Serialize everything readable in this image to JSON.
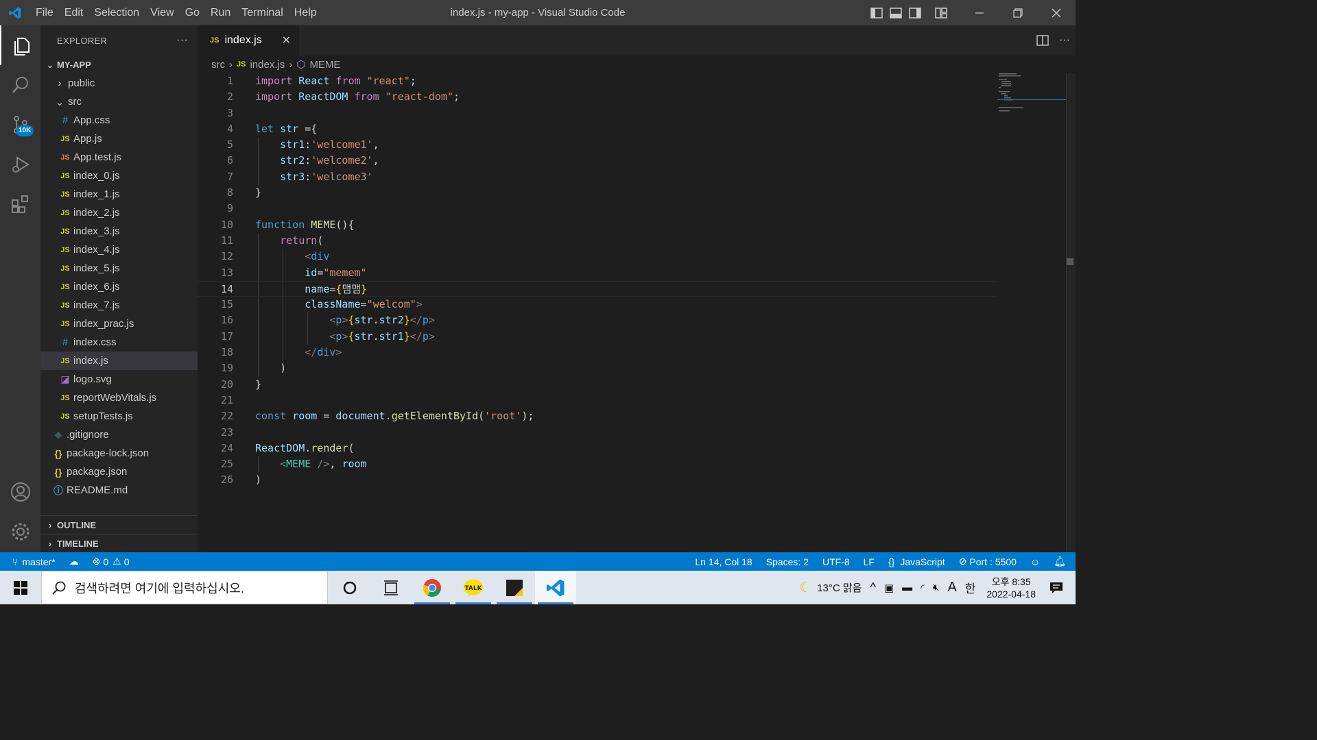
{
  "titlebar": {
    "menu": [
      "File",
      "Edit",
      "Selection",
      "View",
      "Go",
      "Run",
      "Terminal",
      "Help"
    ],
    "title": "index.js - my-app - Visual Studio Code"
  },
  "activitybar": {
    "scm_badge": "10K"
  },
  "explorer": {
    "header": "EXPLORER",
    "more": "···",
    "root": "MY-APP",
    "items": [
      {
        "label": "public",
        "kind": "folder-collapsed",
        "indent": 1
      },
      {
        "label": "src",
        "kind": "folder-open",
        "indent": 1
      },
      {
        "label": "App.css",
        "kind": "css",
        "indent": 2
      },
      {
        "label": "App.js",
        "kind": "js",
        "indent": 2
      },
      {
        "label": "App.test.js",
        "kind": "jstest",
        "indent": 2
      },
      {
        "label": "index_0.js",
        "kind": "js",
        "indent": 2
      },
      {
        "label": "index_1.js",
        "kind": "js",
        "indent": 2
      },
      {
        "label": "index_2.js",
        "kind": "js",
        "indent": 2
      },
      {
        "label": "index_3.js",
        "kind": "js",
        "indent": 2
      },
      {
        "label": "index_4.js",
        "kind": "js",
        "indent": 2
      },
      {
        "label": "index_5.js",
        "kind": "js",
        "indent": 2
      },
      {
        "label": "index_6.js",
        "kind": "js",
        "indent": 2
      },
      {
        "label": "index_7.js",
        "kind": "js",
        "indent": 2
      },
      {
        "label": "index_prac.js",
        "kind": "js",
        "indent": 2
      },
      {
        "label": "index.css",
        "kind": "css",
        "indent": 2
      },
      {
        "label": "index.js",
        "kind": "js",
        "indent": 2,
        "selected": true
      },
      {
        "label": "logo.svg",
        "kind": "svg",
        "indent": 2
      },
      {
        "label": "reportWebVitals.js",
        "kind": "js",
        "indent": 2
      },
      {
        "label": "setupTests.js",
        "kind": "js",
        "indent": 2
      },
      {
        "label": ".gitignore",
        "kind": "git",
        "indent": 1
      },
      {
        "label": "package-lock.json",
        "kind": "json",
        "indent": 1
      },
      {
        "label": "package.json",
        "kind": "json",
        "indent": 1
      },
      {
        "label": "README.md",
        "kind": "info",
        "indent": 1
      }
    ],
    "outline": "OUTLINE",
    "timeline": "TIMELINE"
  },
  "editor": {
    "tab_label": "index.js",
    "tab_badge": "JS",
    "breadcrumb": [
      "src",
      "index.js",
      "MEME"
    ],
    "current_line": 14,
    "lines": [
      [
        [
          "kw2",
          "import"
        ],
        [
          "plain",
          " "
        ],
        [
          "var",
          "React"
        ],
        [
          "plain",
          " "
        ],
        [
          "kw2",
          "from"
        ],
        [
          "plain",
          " "
        ],
        [
          "str",
          "\"react\""
        ],
        [
          "plain",
          ";"
        ]
      ],
      [
        [
          "kw2",
          "import"
        ],
        [
          "plain",
          " "
        ],
        [
          "var",
          "ReactDOM"
        ],
        [
          "plain",
          " "
        ],
        [
          "kw2",
          "from"
        ],
        [
          "plain",
          " "
        ],
        [
          "str",
          "\"react-dom\""
        ],
        [
          "plain",
          ";"
        ]
      ],
      [],
      [
        [
          "kw",
          "let"
        ],
        [
          "plain",
          " "
        ],
        [
          "var",
          "str"
        ],
        [
          "plain",
          " ={"
        ]
      ],
      [
        [
          "plain",
          "    "
        ],
        [
          "var",
          "str1"
        ],
        [
          "plain",
          ":"
        ],
        [
          "str",
          "'welcome1'"
        ],
        [
          "plain",
          ","
        ]
      ],
      [
        [
          "plain",
          "    "
        ],
        [
          "var",
          "str2"
        ],
        [
          "plain",
          ":"
        ],
        [
          "str",
          "'welcome2'"
        ],
        [
          "plain",
          ","
        ]
      ],
      [
        [
          "plain",
          "    "
        ],
        [
          "var",
          "str3"
        ],
        [
          "plain",
          ":"
        ],
        [
          "str",
          "'welcome3'"
        ]
      ],
      [
        [
          "plain",
          "}"
        ]
      ],
      [],
      [
        [
          "kw",
          "function"
        ],
        [
          "plain",
          " "
        ],
        [
          "fn",
          "MEME"
        ],
        [
          "plain",
          "(){"
        ]
      ],
      [
        [
          "plain",
          "    "
        ],
        [
          "kw2",
          "return"
        ],
        [
          "plain",
          "("
        ]
      ],
      [
        [
          "plain",
          "        "
        ],
        [
          "brk",
          "<"
        ],
        [
          "tag",
          "div"
        ]
      ],
      [
        [
          "plain",
          "        "
        ],
        [
          "var",
          "id"
        ],
        [
          "plain",
          "="
        ],
        [
          "str",
          "\"memem\""
        ]
      ],
      [
        [
          "plain",
          "        "
        ],
        [
          "var",
          "name"
        ],
        [
          "plain",
          "="
        ],
        [
          "ybr",
          "{"
        ],
        [
          "plain",
          "맴맴"
        ],
        [
          "ybr",
          "}"
        ]
      ],
      [
        [
          "plain",
          "        "
        ],
        [
          "var",
          "className"
        ],
        [
          "plain",
          "="
        ],
        [
          "str",
          "\"welcom\""
        ],
        [
          "brk",
          ">"
        ]
      ],
      [
        [
          "plain",
          "            "
        ],
        [
          "brk",
          "<"
        ],
        [
          "tag",
          "p"
        ],
        [
          "brk",
          ">"
        ],
        [
          "ybr",
          "{"
        ],
        [
          "var",
          "str"
        ],
        [
          "plain",
          "."
        ],
        [
          "var",
          "str2"
        ],
        [
          "ybr",
          "}"
        ],
        [
          "brk",
          "</"
        ],
        [
          "tag",
          "p"
        ],
        [
          "brk",
          ">"
        ]
      ],
      [
        [
          "plain",
          "            "
        ],
        [
          "brk",
          "<"
        ],
        [
          "tag",
          "p"
        ],
        [
          "brk",
          ">"
        ],
        [
          "ybr",
          "{"
        ],
        [
          "var",
          "str"
        ],
        [
          "plain",
          "."
        ],
        [
          "var",
          "str1"
        ],
        [
          "ybr",
          "}"
        ],
        [
          "brk",
          "</"
        ],
        [
          "tag",
          "p"
        ],
        [
          "brk",
          ">"
        ]
      ],
      [
        [
          "plain",
          "        "
        ],
        [
          "brk",
          "</"
        ],
        [
          "tag",
          "div"
        ],
        [
          "brk",
          ">"
        ]
      ],
      [
        [
          "plain",
          "    )"
        ]
      ],
      [
        [
          "plain",
          "}"
        ]
      ],
      [],
      [
        [
          "kw",
          "const"
        ],
        [
          "plain",
          " "
        ],
        [
          "var",
          "room"
        ],
        [
          "plain",
          " = "
        ],
        [
          "var",
          "document"
        ],
        [
          "plain",
          "."
        ],
        [
          "fn",
          "getElementById"
        ],
        [
          "plain",
          "("
        ],
        [
          "str",
          "'root'"
        ],
        [
          "plain",
          ");"
        ]
      ],
      [],
      [
        [
          "var",
          "ReactDOM"
        ],
        [
          "plain",
          "."
        ],
        [
          "fn",
          "render"
        ],
        [
          "plain",
          "("
        ]
      ],
      [
        [
          "plain",
          "    "
        ],
        [
          "brk",
          "<"
        ],
        [
          "cls",
          "MEME"
        ],
        [
          "plain",
          " "
        ],
        [
          "brk",
          "/>"
        ],
        [
          "plain",
          ", "
        ],
        [
          "var",
          "room"
        ]
      ],
      [
        [
          "plain",
          ")"
        ]
      ]
    ]
  },
  "statusbar": {
    "branch": "master*",
    "errors": "0",
    "warnings": "0",
    "position": "Ln 14, Col 18",
    "spaces": "Spaces: 2",
    "encoding": "UTF-8",
    "eol": "LF",
    "language": "JavaScript",
    "port": "Port : 5500"
  },
  "taskbar": {
    "search_placeholder": "검색하려면 여기에 입력하십시오.",
    "weather": "13°C  맑음",
    "ime": "한",
    "ime_mode": "A",
    "time": "오후 8:35",
    "date": "2022-04-18"
  },
  "colors": {
    "statusbar": "#007acc",
    "titlebar": "#3c3c3c",
    "sidebar": "#252526",
    "editor": "#1e1e1e"
  }
}
